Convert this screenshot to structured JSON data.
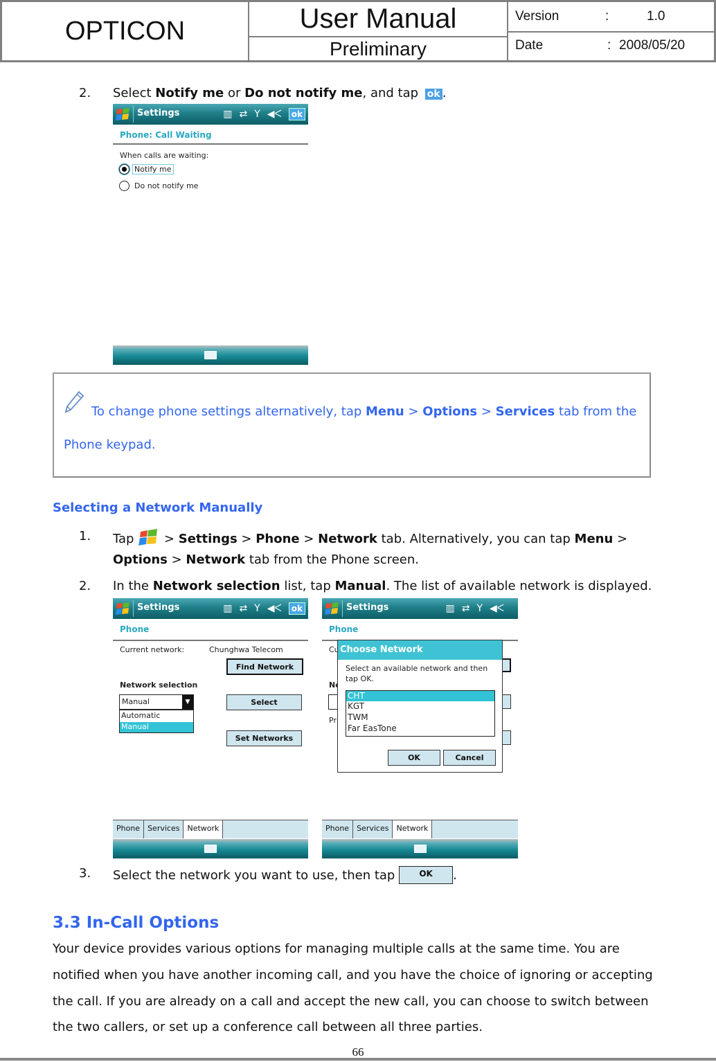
{
  "header": {
    "company": "OPTICON",
    "doc_title": "User Manual",
    "status": "Preliminary",
    "version_label": "Version",
    "version_sep": ":",
    "version_value": "1.0",
    "date_label": "Date",
    "date_sep": ":",
    "date_value": "2008/05/20"
  },
  "step_call_waiting": {
    "number": "2.",
    "text_prefix": "Select ",
    "opt1": "Notify me",
    "mid": " or ",
    "opt2": "Do not notify me",
    "suffix": ", and tap ",
    "ok_icon_label": "ok",
    "end": "."
  },
  "screen1": {
    "title": "Settings",
    "ok": "ok",
    "subheading": "Phone: Call Waiting",
    "prompt": "When calls are waiting:",
    "radio_options": [
      {
        "label": "Notify me",
        "selected": true
      },
      {
        "label": "Do not notify me",
        "selected": false
      }
    ]
  },
  "note": {
    "icon": "pencil-icon",
    "text1": "To change phone settings alternatively, tap ",
    "menu": "Menu",
    "sep": " > ",
    "options": "Options",
    "services": "Services",
    "text2": " tab from the",
    "line2": "Phone keypad."
  },
  "section_network": {
    "heading": "Selecting a Network Manually",
    "step1": {
      "number": "1.",
      "tap": "Tap ",
      "s1": " > ",
      "settings": "Settings",
      "phone": "Phone",
      "network": "Network",
      "rest1": " tab. Alternatively, you can tap ",
      "menu": "Menu",
      "gt": " >",
      "options": "Options",
      "network2": "Network",
      "rest2": " tab from the Phone screen."
    },
    "step2": {
      "number": "2.",
      "in_the": "In the ",
      "network_selection": "Network selection",
      "list_tap": " list, tap ",
      "manual": "Manual",
      "rest": ". The list of available network is displayed."
    },
    "step3": {
      "number": "3.",
      "text": "Select the network you want to use, then tap ",
      "ok_button": "OK",
      "end": "."
    }
  },
  "screen2": {
    "title": "Settings",
    "ok": "ok",
    "subheading": "Phone",
    "current_network_label": "Current network:",
    "current_network_value": "Chunghwa Telecom",
    "find_network": "Find Network",
    "network_selection_label": "Network selection",
    "dropdown_value": "Manual",
    "dropdown_options": [
      "Automatic",
      "Manual"
    ],
    "select_button": "Select",
    "set_networks_button": "Set Networks",
    "tabs": [
      "Phone",
      "Services",
      "Network"
    ],
    "active_tab": "Network"
  },
  "screen3": {
    "title": "Settings",
    "subheading": "Phone",
    "dialog_title": "Choose Network",
    "dialog_text": "Select an available network and then tap OK.",
    "networks": [
      "CHT",
      "KGT",
      "TWM",
      "Far EasTone"
    ],
    "selected_network": "CHT",
    "ok_button": "OK",
    "cancel_button": "Cancel",
    "tabs": [
      "Phone",
      "Services",
      "Network"
    ],
    "active_tab": "Network"
  },
  "section_incall": {
    "heading": "3.3 In-Call Options",
    "lines": [
      "Your device provides various options for managing multiple calls at the same time. You are",
      "notified when you have another incoming call, and you have the choice of ignoring or accepting",
      "the call. If you are already on a call and accept the new call, you can choose to switch between",
      "the two callers, or set up a conference call between all three parties."
    ]
  },
  "footer": {
    "page_number": "66"
  },
  "colors": {
    "accent_blue": "#3366ee",
    "wm_teal": "#1f7f88",
    "highlight": "#33c3d6"
  }
}
